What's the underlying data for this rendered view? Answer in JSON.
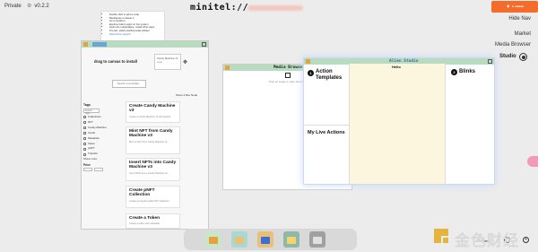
{
  "topbar": {
    "private_label": "Private",
    "version": "v0.2.2",
    "version_mark": "⚙",
    "site_title": "minitel://",
    "connect_label": "▼  •  •••••"
  },
  "right_nav": {
    "hide_nav": "Hide Nav",
    "market": "Market",
    "media_browser": "Media Browser",
    "studio": "Studio"
  },
  "tips": {
    "items": [
      "Double click to add a node",
      "Backspace to delete it",
      "Go to desktop",
      "Explore built-in apps on the system",
      "Open the marketplace, install other apps",
      "Top left, switch public/private Minitel",
      "Discord for support"
    ]
  },
  "template_panel": {
    "drop_label": "drag to canvas to install",
    "drop_box_text": "Candy Machine v3\n••••••",
    "search_placeholder": "Search a template...",
    "show_all": "Show 4 Dev Node",
    "tags_title": "Tags",
    "tag_search_placeholder": "Search tags...",
    "tags": [
      "Collections",
      "NFT",
      "Candy Machine",
      "Cards",
      "Metadata",
      "Token",
      "pNFT",
      "Transfer",
      "Show more"
    ],
    "price_title": "Price",
    "cards": [
      {
        "title": "Create Candy Machine v3",
        "desc": "Create a Candy Machine v3 with guards"
      },
      {
        "title": "Mint NFT from Candy Machine v3",
        "desc": "Mint an NFT from Candy Machine v3"
      },
      {
        "title": "Insert NFTs into Candy Machine v3",
        "desc": "Insert NFTs into a Candy Machine v3"
      },
      {
        "title": "Create pNFT Collection",
        "desc": "Create a programmable NFT collection"
      },
      {
        "title": "Create a Token",
        "desc": "Create a token with metadata"
      }
    ]
  },
  "media_panel": {
    "title": "Media Browser",
    "hint": "Drop an image or video here to upload"
  },
  "studio_panel": {
    "title": "Alien Studio",
    "action_num": "1",
    "action_title": "Action\nTemplates",
    "hello": "Hello",
    "blinks_num": "2",
    "blinks_title": "Blinks",
    "live_title": "My Live Actions"
  },
  "dock": {
    "apps": [
      {
        "icon": "storefront-icon",
        "color": "#c8e6c9",
        "accent": "#e8a23a"
      },
      {
        "icon": "plant-shop-icon",
        "color": "#a8d8d0",
        "accent": "#e8c07a"
      },
      {
        "icon": "folder-icon",
        "color": "#e8c07a",
        "accent": "#3a6fd8"
      },
      {
        "icon": "calculator-icon",
        "color": "#8fb8a8",
        "accent": "#f2d66b"
      },
      {
        "icon": "box-icon",
        "color": "#a0a0a0",
        "accent": "#e0e0e0"
      }
    ]
  },
  "view_controls": {
    "fit_view": "Fit View",
    "zoom_out": "−",
    "zoom_in": "+"
  },
  "watermark": {
    "text": "金色财经"
  },
  "colors": {
    "accent": "#f46b2a",
    "panel_bar": "#b8dcc0",
    "desktop": "#ececec"
  }
}
